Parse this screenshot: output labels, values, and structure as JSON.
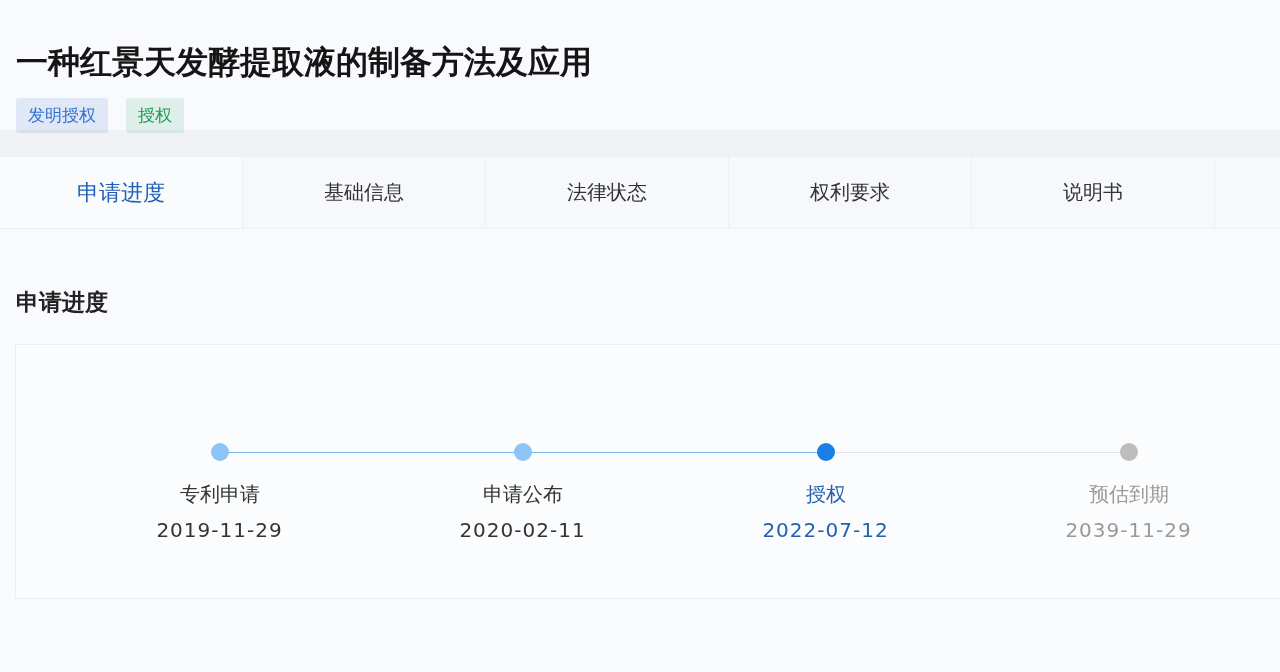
{
  "title": "一种红景天发酵提取液的制备方法及应用",
  "tags": [
    {
      "label": "发明授权",
      "color": "#2f6fd0"
    },
    {
      "label": "授权",
      "color": "#1f9a55"
    }
  ],
  "tabs": [
    {
      "label": "申请进度",
      "selected": true
    },
    {
      "label": "基础信息",
      "selected": false
    },
    {
      "label": "法律状态",
      "selected": false
    },
    {
      "label": "权利要求",
      "selected": false
    },
    {
      "label": "说明书",
      "selected": false
    }
  ],
  "section_title": "申请进度",
  "steps": [
    {
      "label": "专利申请",
      "date": "2019-11-29",
      "reached": true,
      "current": false
    },
    {
      "label": "申请公布",
      "date": "2020-02-11",
      "reached": true,
      "current": false
    },
    {
      "label": "授权",
      "date": "2022-07-12",
      "reached": true,
      "current": true
    },
    {
      "label": "预估到期",
      "date": "2039-11-29",
      "reached": false,
      "current": false
    }
  ]
}
